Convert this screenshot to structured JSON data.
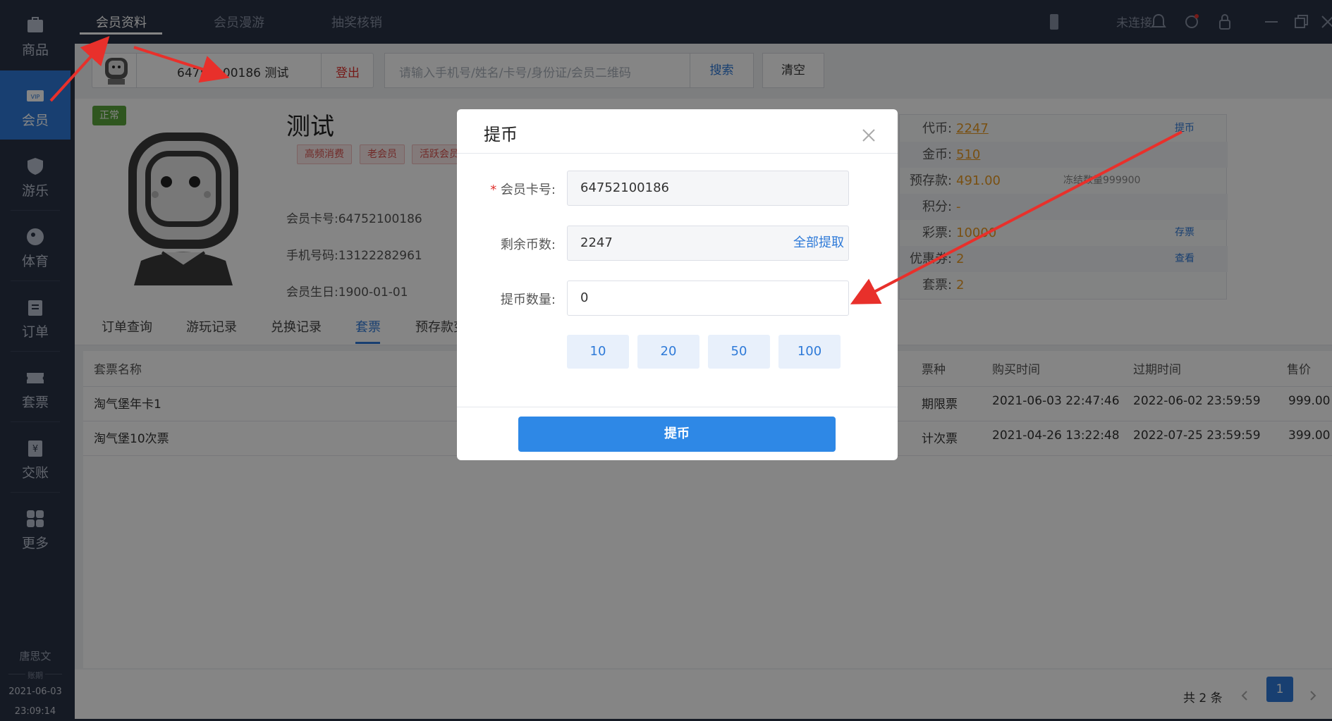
{
  "sidebar": {
    "items": [
      {
        "label": "商品",
        "icon": "product-icon"
      },
      {
        "label": "会员",
        "icon": "vip-icon"
      },
      {
        "label": "游乐",
        "icon": "shield-icon"
      },
      {
        "label": "体育",
        "icon": "ball-icon"
      },
      {
        "label": "订单",
        "icon": "clipboard-icon"
      },
      {
        "label": "套票",
        "icon": "ticket-icon"
      },
      {
        "label": "交账",
        "icon": "yen-icon"
      },
      {
        "label": "更多",
        "icon": "grid-icon"
      }
    ],
    "user": "唐思文",
    "date_label": "账期",
    "date": "2021-06-03",
    "time": "23:09:14"
  },
  "topbar": {
    "tabs": [
      "会员资料",
      "会员漫游",
      "抽奖核销"
    ],
    "connection": "未连接"
  },
  "member_bar": {
    "card_name": "64752100186 测试",
    "logout": "登出",
    "search_placeholder": "请输入手机号/姓名/卡号/身份证/会员二维码",
    "search": "搜索",
    "clear": "清空"
  },
  "profile": {
    "status": "正常",
    "name": "测试",
    "tags": [
      "高频消费",
      "老会员",
      "活跃会员"
    ],
    "card_label": "会员卡号:",
    "card": "64752100186",
    "phone_label": "手机号码:",
    "phone": "13122282961",
    "birthday_label": "会员生日:",
    "birthday": "1900-01-01"
  },
  "coins": {
    "token_label": "代币:",
    "token": "2247",
    "token_action": "提币",
    "gold_label": "金币:",
    "gold": "510",
    "deposit_label": "预存款:",
    "deposit": "491.00",
    "frozen": "冻结数量999900",
    "points_label": "积分:",
    "points": "-",
    "lottery_label": "彩票:",
    "lottery": "10000",
    "lottery_action": "存票",
    "coupon_label": "优惠券:",
    "coupon": "2",
    "coupon_action": "查看",
    "package_label": "套票:",
    "package": "2"
  },
  "subtabs": [
    "订单查询",
    "游玩记录",
    "兑换记录",
    "套票",
    "预存款变"
  ],
  "table": {
    "headers": [
      "套票名称",
      "票种",
      "购买时间",
      "过期时间",
      "售价"
    ],
    "rows": [
      [
        "淘气堡年卡1",
        "期限票",
        "2021-06-03 22:47:46",
        "2022-06-02 23:59:59",
        "999.00"
      ],
      [
        "淘气堡10次票",
        "计次票",
        "2021-04-26 13:22:48",
        "2022-07-25 23:59:59",
        "399.00"
      ]
    ],
    "total": "共 2 条",
    "page": "1"
  },
  "modal": {
    "title": "提币",
    "card_label": "会员卡号:",
    "card": "64752100186",
    "remain_label": "剩余币数:",
    "remain": "2247",
    "withdraw_all": "全部提取",
    "amount_label": "提币数量:",
    "amount": "0",
    "quick": [
      "10",
      "20",
      "50",
      "100"
    ],
    "submit": "提币"
  }
}
